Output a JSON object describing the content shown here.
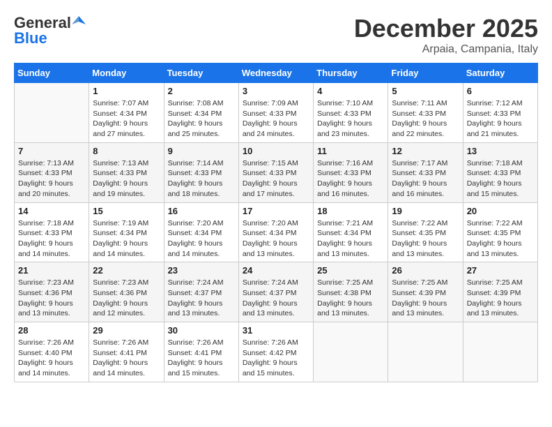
{
  "header": {
    "logo_line1": "General",
    "logo_line2": "Blue",
    "month_title": "December 2025",
    "subtitle": "Arpaia, Campania, Italy"
  },
  "days_of_week": [
    "Sunday",
    "Monday",
    "Tuesday",
    "Wednesday",
    "Thursday",
    "Friday",
    "Saturday"
  ],
  "weeks": [
    [
      {
        "day": "",
        "info": ""
      },
      {
        "day": "1",
        "info": "Sunrise: 7:07 AM\nSunset: 4:34 PM\nDaylight: 9 hours\nand 27 minutes."
      },
      {
        "day": "2",
        "info": "Sunrise: 7:08 AM\nSunset: 4:34 PM\nDaylight: 9 hours\nand 25 minutes."
      },
      {
        "day": "3",
        "info": "Sunrise: 7:09 AM\nSunset: 4:33 PM\nDaylight: 9 hours\nand 24 minutes."
      },
      {
        "day": "4",
        "info": "Sunrise: 7:10 AM\nSunset: 4:33 PM\nDaylight: 9 hours\nand 23 minutes."
      },
      {
        "day": "5",
        "info": "Sunrise: 7:11 AM\nSunset: 4:33 PM\nDaylight: 9 hours\nand 22 minutes."
      },
      {
        "day": "6",
        "info": "Sunrise: 7:12 AM\nSunset: 4:33 PM\nDaylight: 9 hours\nand 21 minutes."
      }
    ],
    [
      {
        "day": "7",
        "info": "Sunrise: 7:13 AM\nSunset: 4:33 PM\nDaylight: 9 hours\nand 20 minutes."
      },
      {
        "day": "8",
        "info": "Sunrise: 7:13 AM\nSunset: 4:33 PM\nDaylight: 9 hours\nand 19 minutes."
      },
      {
        "day": "9",
        "info": "Sunrise: 7:14 AM\nSunset: 4:33 PM\nDaylight: 9 hours\nand 18 minutes."
      },
      {
        "day": "10",
        "info": "Sunrise: 7:15 AM\nSunset: 4:33 PM\nDaylight: 9 hours\nand 17 minutes."
      },
      {
        "day": "11",
        "info": "Sunrise: 7:16 AM\nSunset: 4:33 PM\nDaylight: 9 hours\nand 16 minutes."
      },
      {
        "day": "12",
        "info": "Sunrise: 7:17 AM\nSunset: 4:33 PM\nDaylight: 9 hours\nand 16 minutes."
      },
      {
        "day": "13",
        "info": "Sunrise: 7:18 AM\nSunset: 4:33 PM\nDaylight: 9 hours\nand 15 minutes."
      }
    ],
    [
      {
        "day": "14",
        "info": "Sunrise: 7:18 AM\nSunset: 4:33 PM\nDaylight: 9 hours\nand 14 minutes."
      },
      {
        "day": "15",
        "info": "Sunrise: 7:19 AM\nSunset: 4:34 PM\nDaylight: 9 hours\nand 14 minutes."
      },
      {
        "day": "16",
        "info": "Sunrise: 7:20 AM\nSunset: 4:34 PM\nDaylight: 9 hours\nand 14 minutes."
      },
      {
        "day": "17",
        "info": "Sunrise: 7:20 AM\nSunset: 4:34 PM\nDaylight: 9 hours\nand 13 minutes."
      },
      {
        "day": "18",
        "info": "Sunrise: 7:21 AM\nSunset: 4:34 PM\nDaylight: 9 hours\nand 13 minutes."
      },
      {
        "day": "19",
        "info": "Sunrise: 7:22 AM\nSunset: 4:35 PM\nDaylight: 9 hours\nand 13 minutes."
      },
      {
        "day": "20",
        "info": "Sunrise: 7:22 AM\nSunset: 4:35 PM\nDaylight: 9 hours\nand 13 minutes."
      }
    ],
    [
      {
        "day": "21",
        "info": "Sunrise: 7:23 AM\nSunset: 4:36 PM\nDaylight: 9 hours\nand 13 minutes."
      },
      {
        "day": "22",
        "info": "Sunrise: 7:23 AM\nSunset: 4:36 PM\nDaylight: 9 hours\nand 12 minutes."
      },
      {
        "day": "23",
        "info": "Sunrise: 7:24 AM\nSunset: 4:37 PM\nDaylight: 9 hours\nand 13 minutes."
      },
      {
        "day": "24",
        "info": "Sunrise: 7:24 AM\nSunset: 4:37 PM\nDaylight: 9 hours\nand 13 minutes."
      },
      {
        "day": "25",
        "info": "Sunrise: 7:25 AM\nSunset: 4:38 PM\nDaylight: 9 hours\nand 13 minutes."
      },
      {
        "day": "26",
        "info": "Sunrise: 7:25 AM\nSunset: 4:39 PM\nDaylight: 9 hours\nand 13 minutes."
      },
      {
        "day": "27",
        "info": "Sunrise: 7:25 AM\nSunset: 4:39 PM\nDaylight: 9 hours\nand 13 minutes."
      }
    ],
    [
      {
        "day": "28",
        "info": "Sunrise: 7:26 AM\nSunset: 4:40 PM\nDaylight: 9 hours\nand 14 minutes."
      },
      {
        "day": "29",
        "info": "Sunrise: 7:26 AM\nSunset: 4:41 PM\nDaylight: 9 hours\nand 14 minutes."
      },
      {
        "day": "30",
        "info": "Sunrise: 7:26 AM\nSunset: 4:41 PM\nDaylight: 9 hours\nand 15 minutes."
      },
      {
        "day": "31",
        "info": "Sunrise: 7:26 AM\nSunset: 4:42 PM\nDaylight: 9 hours\nand 15 minutes."
      },
      {
        "day": "",
        "info": ""
      },
      {
        "day": "",
        "info": ""
      },
      {
        "day": "",
        "info": ""
      }
    ]
  ]
}
